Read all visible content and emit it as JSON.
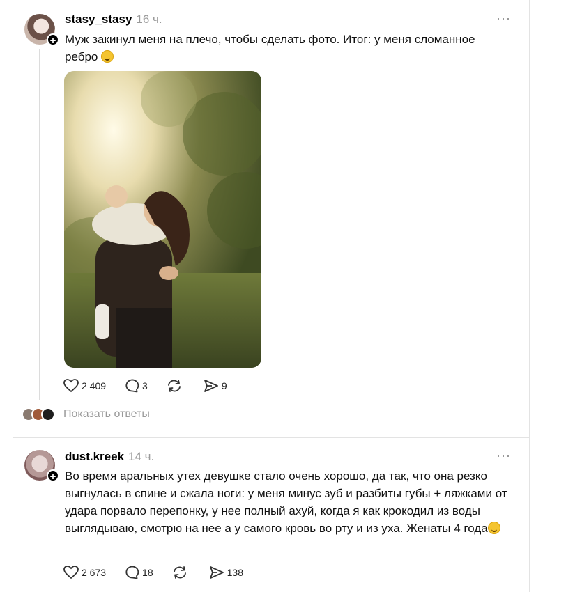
{
  "posts": [
    {
      "username": "stasy_stasy",
      "time": "16 ч.",
      "text": "Муж закинул меня на плечо, чтобы сделать фото. Итог: у меня сломанное ребро",
      "likes": "2 409",
      "comments": "3",
      "shares": "9"
    },
    {
      "username": "dust.kreek",
      "time": "14 ч.",
      "text": "Во время аральных утех девушке стало очень хорошо, да так, что она резко выгнулась в спине и сжала ноги: у меня минус зуб и разбиты губы + ляжками от удара порвало перепонку, у нее полный ахуй, когда я как крокодил из воды выглядываю, смотрю на нее а у самого кровь во рту и из уха. Женаты 4 года",
      "likes": "2 673",
      "comments": "18",
      "shares": "138"
    }
  ],
  "replies_link": "Показать ответы",
  "more_label": "···",
  "icons": {
    "like": "heart-icon",
    "comment": "comment-icon",
    "repost": "repost-icon",
    "share": "share-icon",
    "follow": "plus-icon",
    "emoji": "laughing-emoji-icon"
  },
  "colors": {
    "muted": "#9a9a9a",
    "border": "#e3e3e3"
  }
}
